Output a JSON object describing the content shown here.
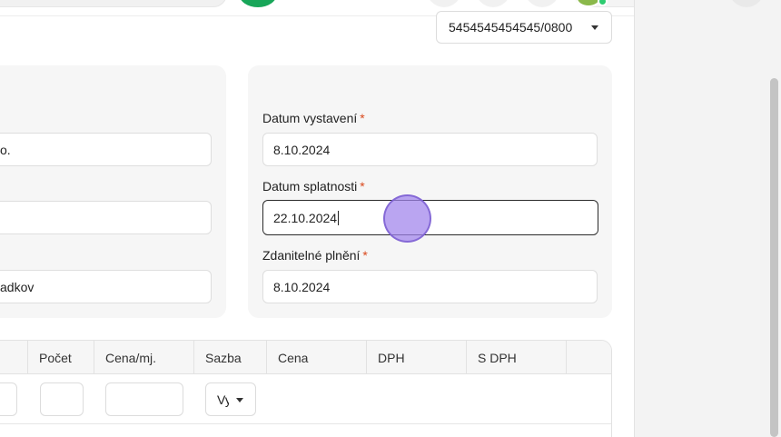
{
  "header": {
    "account_number": "5454545454545/0800"
  },
  "left_card": {
    "field1_value": "o.",
    "field2_value": "",
    "field3_value": "adkov"
  },
  "dates": {
    "issue_label": "Datum vystavení",
    "issue_value": "8.10.2024",
    "due_label": "Datum splatnosti",
    "due_value": "22.10.2024",
    "taxable_label": "Zdanitelné plnění",
    "taxable_value": "8.10.2024",
    "required_mark": "*"
  },
  "items_table": {
    "columns": [
      "Počet",
      "Cena/mj.",
      "Sazba",
      "Cena",
      "DPH",
      "S DPH"
    ],
    "row": {
      "quantity": "",
      "unit_price": "",
      "vat_rate": "Vy"
    }
  }
}
